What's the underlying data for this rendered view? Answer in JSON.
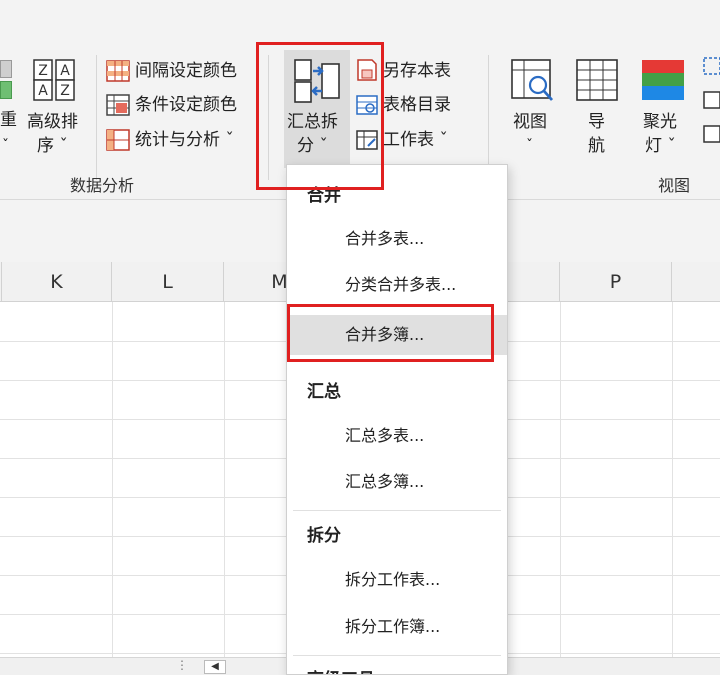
{
  "ribbon": {
    "left_partial_top": "重",
    "left_partial_bottom": "ˇ",
    "sort": {
      "line1": "高级排",
      "line2": "序 ˇ"
    },
    "data_analysis_items": [
      {
        "label": "间隔设定颜色",
        "icon": "interval-color-icon"
      },
      {
        "label": "条件设定颜色",
        "icon": "condition-color-icon"
      },
      {
        "label": "统计与分析 ˇ",
        "icon": "stats-analysis-icon"
      }
    ],
    "group_data_analysis": "数据分析",
    "merge_split": {
      "line1": "汇总拆",
      "line2": "分 ˇ"
    },
    "sheet_items": [
      {
        "label": "另存本表",
        "icon": "save-sheet-icon"
      },
      {
        "label": "表格目录",
        "icon": "sheet-directory-icon"
      },
      {
        "label": "工作表 ˇ",
        "icon": "worksheet-icon"
      }
    ],
    "view": {
      "line1": "视图",
      "line2": "ˇ"
    },
    "nav": {
      "line1": "导",
      "line2": "航"
    },
    "spotlight": {
      "line1": "聚光",
      "line2": "灯 ˇ"
    },
    "group_view": "视图"
  },
  "columns": [
    "K",
    "L",
    "M",
    "",
    "P"
  ],
  "menu": {
    "sections": [
      {
        "header": "合并",
        "items": [
          "合并多表...",
          "分类合并多表...",
          "合并多簿..."
        ]
      },
      {
        "header": "汇总",
        "items": [
          "汇总多表...",
          "汇总多簿..."
        ]
      },
      {
        "header": "拆分",
        "items": [
          "拆分工作表...",
          "拆分工作簿..."
        ]
      },
      {
        "header": "高级工具",
        "items": []
      }
    ],
    "highlighted_item": "合并多簿..."
  },
  "colors": {
    "highlight_box": "#e02020",
    "accent_blue": "#2b6cc4",
    "menu_highlight": "#e0e0e0"
  }
}
